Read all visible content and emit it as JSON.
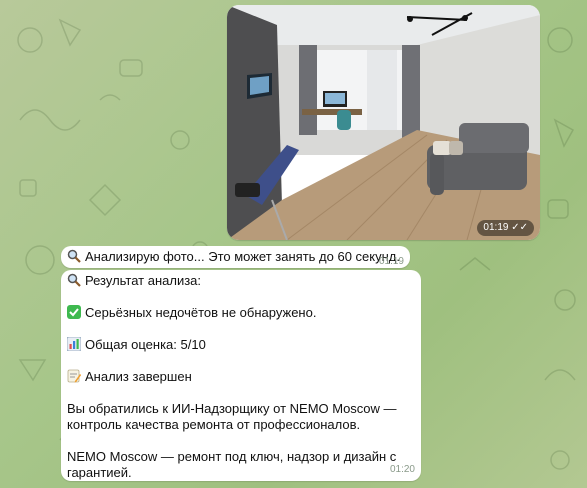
{
  "photo_message": {
    "time": "01:19",
    "read_status_icon": "double-check-icon"
  },
  "status_message": {
    "text": "Анализирую фото... Это может занять до 60 секунд.",
    "time": "01:19",
    "icon": "magnifier-icon"
  },
  "result_message": {
    "time": "01:20",
    "lines": {
      "heading": "Результат анализа:",
      "defects": "Серьёзных недочётов не обнаружено.",
      "score": "Общая оценка: 5/10",
      "done": "Анализ завершен",
      "promo1": "Вы обратились к ИИ-Надзорщику от NEMO Moscow —",
      "promo2": "контроль качества ремонта от профессионалов.",
      "footer1": "NEMO Moscow — ремонт под ключ, надзор и дизайн с",
      "footer2": "гарантией."
    },
    "icons": [
      "magnifier-icon",
      "check-mark-icon",
      "bar-chart-icon",
      "memo-icon"
    ]
  },
  "colors": {
    "background": "#a7c68a",
    "bubble": "#ffffff",
    "check_green": "#3eb94f",
    "time_gray": "#8a9a8a"
  }
}
